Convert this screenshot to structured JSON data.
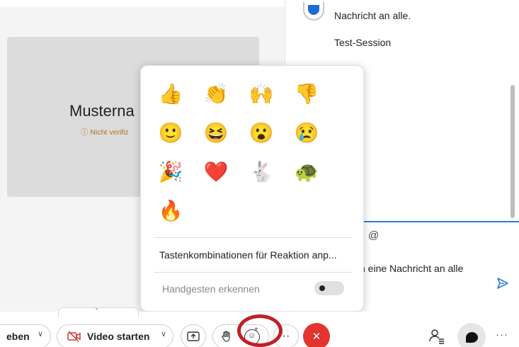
{
  "meeting": {
    "participant_name": "Musterna",
    "verify_note": "ⓘ Nicht verifiz"
  },
  "chat": {
    "messages": [
      "Nachricht an alle.",
      "Test-Session"
    ],
    "mention_symbol": "@",
    "compose_placeholder": "n eine Nachricht an alle"
  },
  "reactions": {
    "emojis": [
      {
        "glyph": "👍",
        "icon": "thumbs-up-icon"
      },
      {
        "glyph": "👏",
        "icon": "clapping-hands-icon"
      },
      {
        "glyph": "🙌",
        "icon": "raised-hands-icon"
      },
      {
        "glyph": "👎",
        "icon": "thumbs-down-icon"
      },
      {
        "glyph": "🙂",
        "icon": "smiling-face-icon"
      },
      {
        "glyph": "😆",
        "icon": "laughing-face-icon"
      },
      {
        "glyph": "😮",
        "icon": "surprised-face-icon"
      },
      {
        "glyph": "😢",
        "icon": "sad-face-icon"
      },
      {
        "glyph": "🎉",
        "icon": "party-popper-icon"
      },
      {
        "glyph": "❤️",
        "icon": "heart-icon"
      },
      {
        "glyph": "🐇",
        "icon": "rabbit-icon"
      },
      {
        "glyph": "🐢",
        "icon": "turtle-icon"
      },
      {
        "glyph": "🔥",
        "icon": "fire-icon"
      }
    ],
    "shortcut_label": "Tastenkombinationen für Reaktion anp...",
    "gesture_label": "Handgesten erkennen",
    "gesture_enabled": false
  },
  "toolbar": {
    "share_label": "eben",
    "video_label": "Video starten",
    "more_label": "··",
    "leave_symbol": "✕",
    "more_right_label": "···",
    "dropdown_symbol": "∨",
    "collapse_symbol": "ˇ"
  },
  "colors": {
    "accent": "#2c7bd1",
    "leave": "#e3342f",
    "highlight": "#c01f24",
    "warning": "#b2731d"
  }
}
